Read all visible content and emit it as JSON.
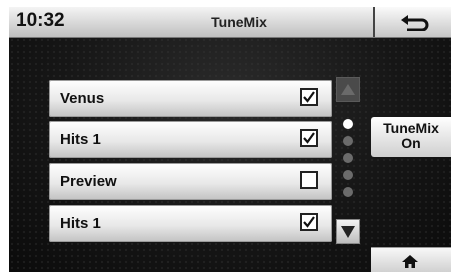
{
  "status_bar": {
    "time": "10:32",
    "title": "TuneMix"
  },
  "icons": {
    "back": "return-arrow-icon",
    "scroll_up": "triangle-up-icon",
    "scroll_down": "triangle-down-icon",
    "home": "home-icon",
    "checkbox_checked": "check-icon"
  },
  "list": {
    "items": [
      {
        "label": "Venus",
        "checked": true
      },
      {
        "label": "Hits 1",
        "checked": true
      },
      {
        "label": "Preview",
        "checked": false
      },
      {
        "label": "Hits 1",
        "checked": true
      }
    ]
  },
  "page_indicator": {
    "total": 5,
    "current": 1
  },
  "side": {
    "tunemix_line1": "TuneMix",
    "tunemix_line2": "On"
  }
}
